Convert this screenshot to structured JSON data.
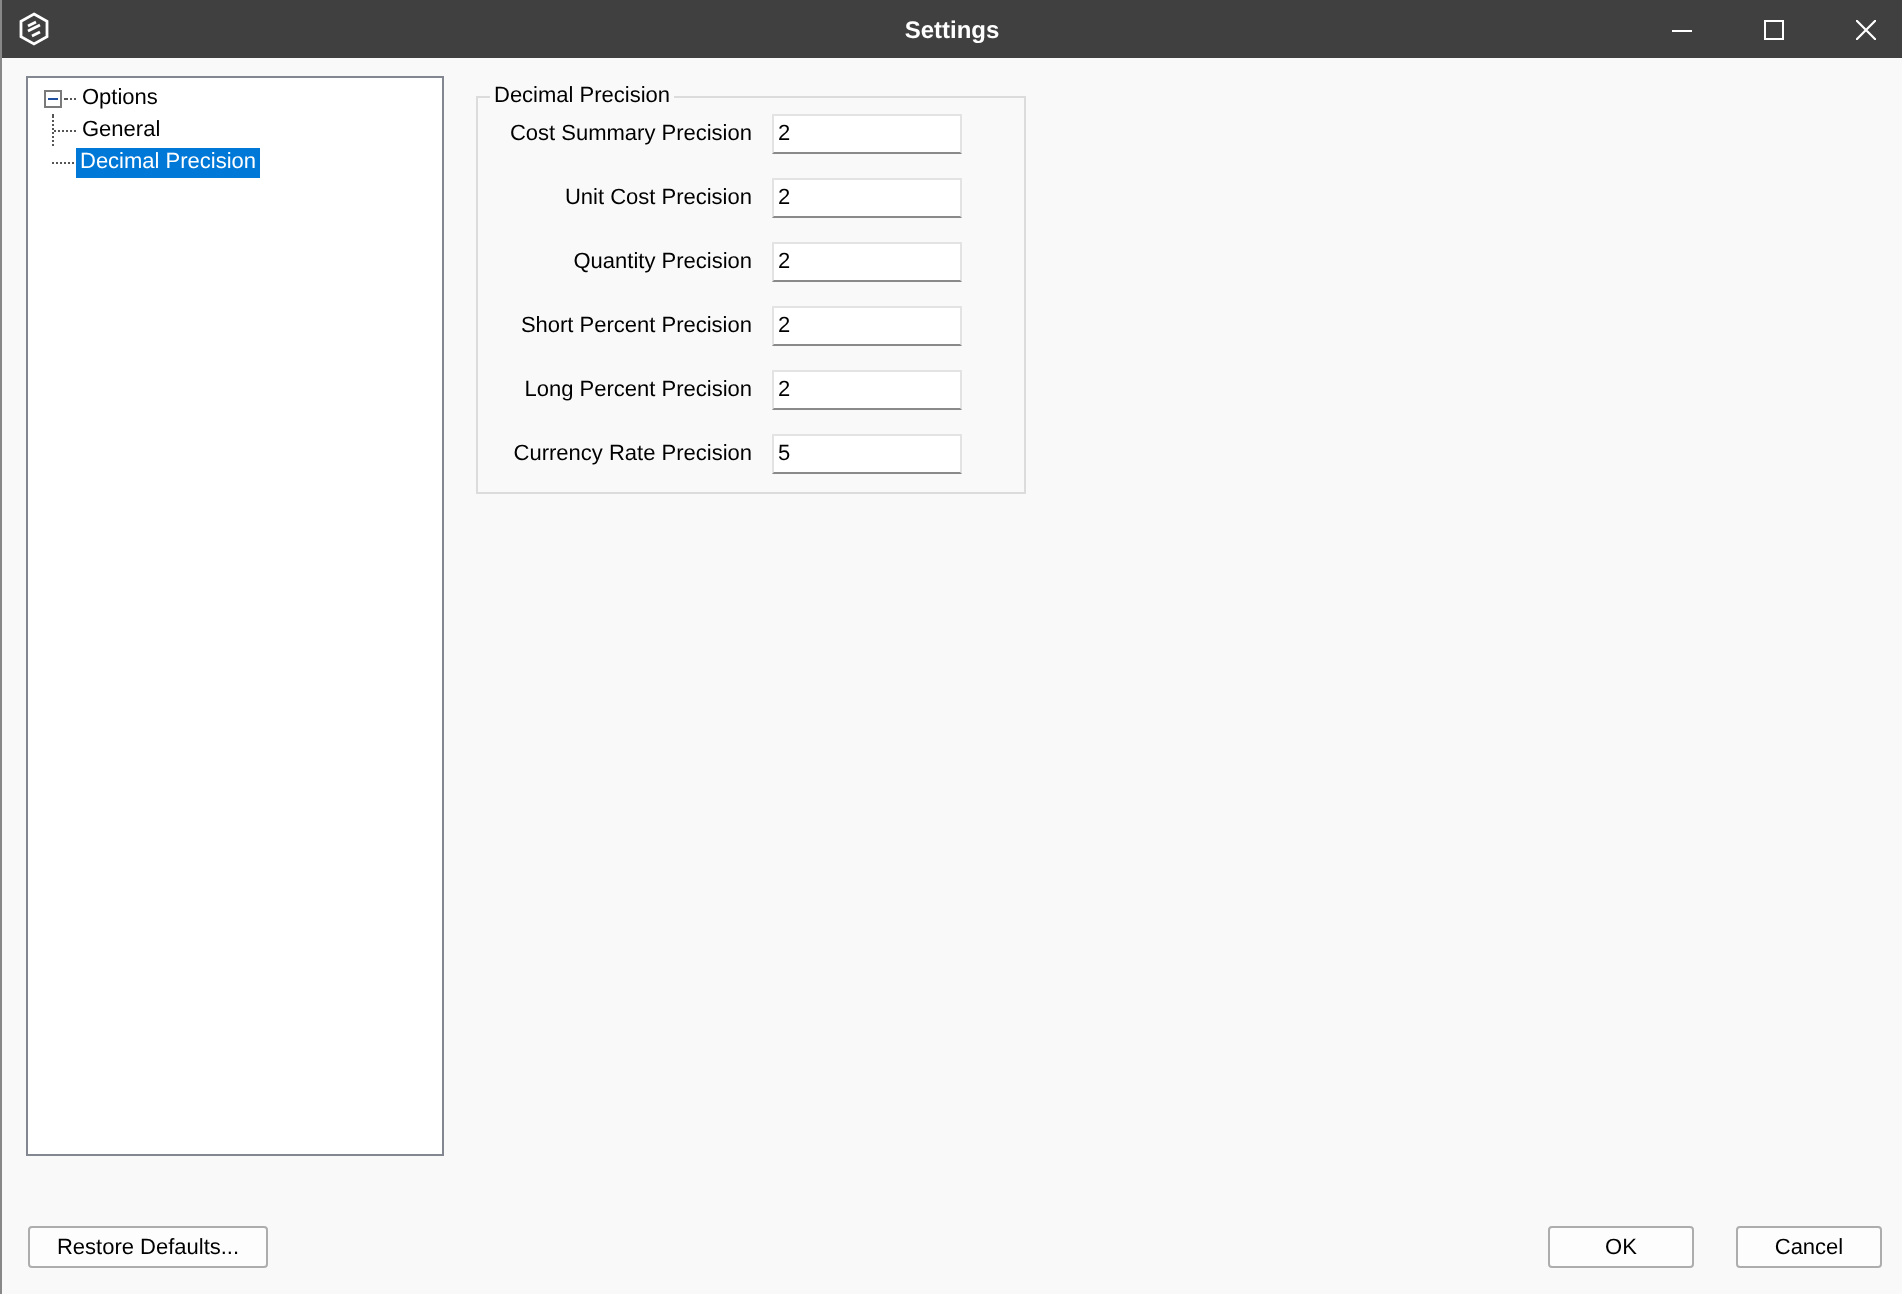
{
  "window": {
    "title": "Settings"
  },
  "tree": [
    {
      "label": "Options",
      "expanded": true,
      "selected": false,
      "children": [
        {
          "label": "General",
          "selected": false
        },
        {
          "label": "Decimal Precision",
          "selected": true
        }
      ]
    }
  ],
  "group": {
    "title": "Decimal Precision",
    "fields": [
      {
        "label": "Cost Summary Precision",
        "value": "2"
      },
      {
        "label": "Unit Cost Precision",
        "value": "2"
      },
      {
        "label": "Quantity Precision",
        "value": "2"
      },
      {
        "label": "Short Percent Precision",
        "value": "2"
      },
      {
        "label": "Long Percent Precision",
        "value": "2"
      },
      {
        "label": "Currency Rate Precision",
        "value": "5"
      }
    ]
  },
  "buttons": {
    "left": [
      "Restore Defaults..."
    ],
    "right": [
      "OK",
      "Cancel"
    ]
  }
}
